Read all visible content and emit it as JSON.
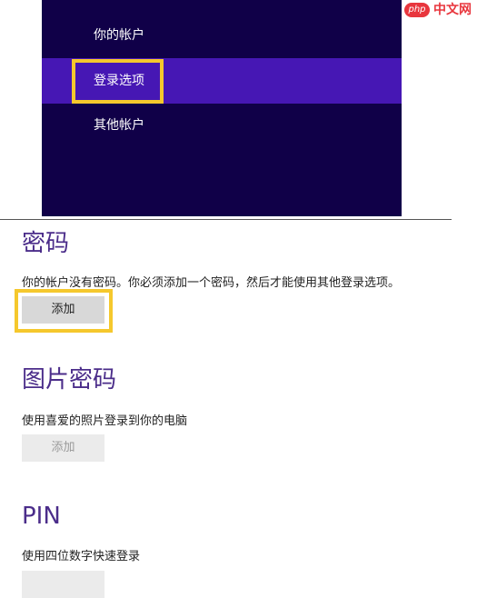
{
  "nav": {
    "items": [
      {
        "label": "你的帐户"
      },
      {
        "label": "登录选项"
      },
      {
        "label": "其他帐户"
      }
    ],
    "selected": "登录选项"
  },
  "watermark": {
    "badge": "php",
    "text": "中文网"
  },
  "password": {
    "heading": "密码",
    "description": "你的帐户没有密码。你必须添加一个密码，然后才能使用其他登录选项。",
    "button_label": "添加"
  },
  "picture_password": {
    "heading": "图片密码",
    "description": "使用喜爱的照片登录到你的电脑",
    "button_label": "添加"
  },
  "pin": {
    "heading": "PIN",
    "description": "使用四位数字快速登录",
    "button_label": ""
  },
  "colors": {
    "nav_background": "#100048",
    "nav_selected": "#4617b4",
    "heading": "#4b2d8a",
    "highlight": "#f5c82d",
    "button": "#d8d8d8",
    "button_disabled": "#ebebeb"
  }
}
